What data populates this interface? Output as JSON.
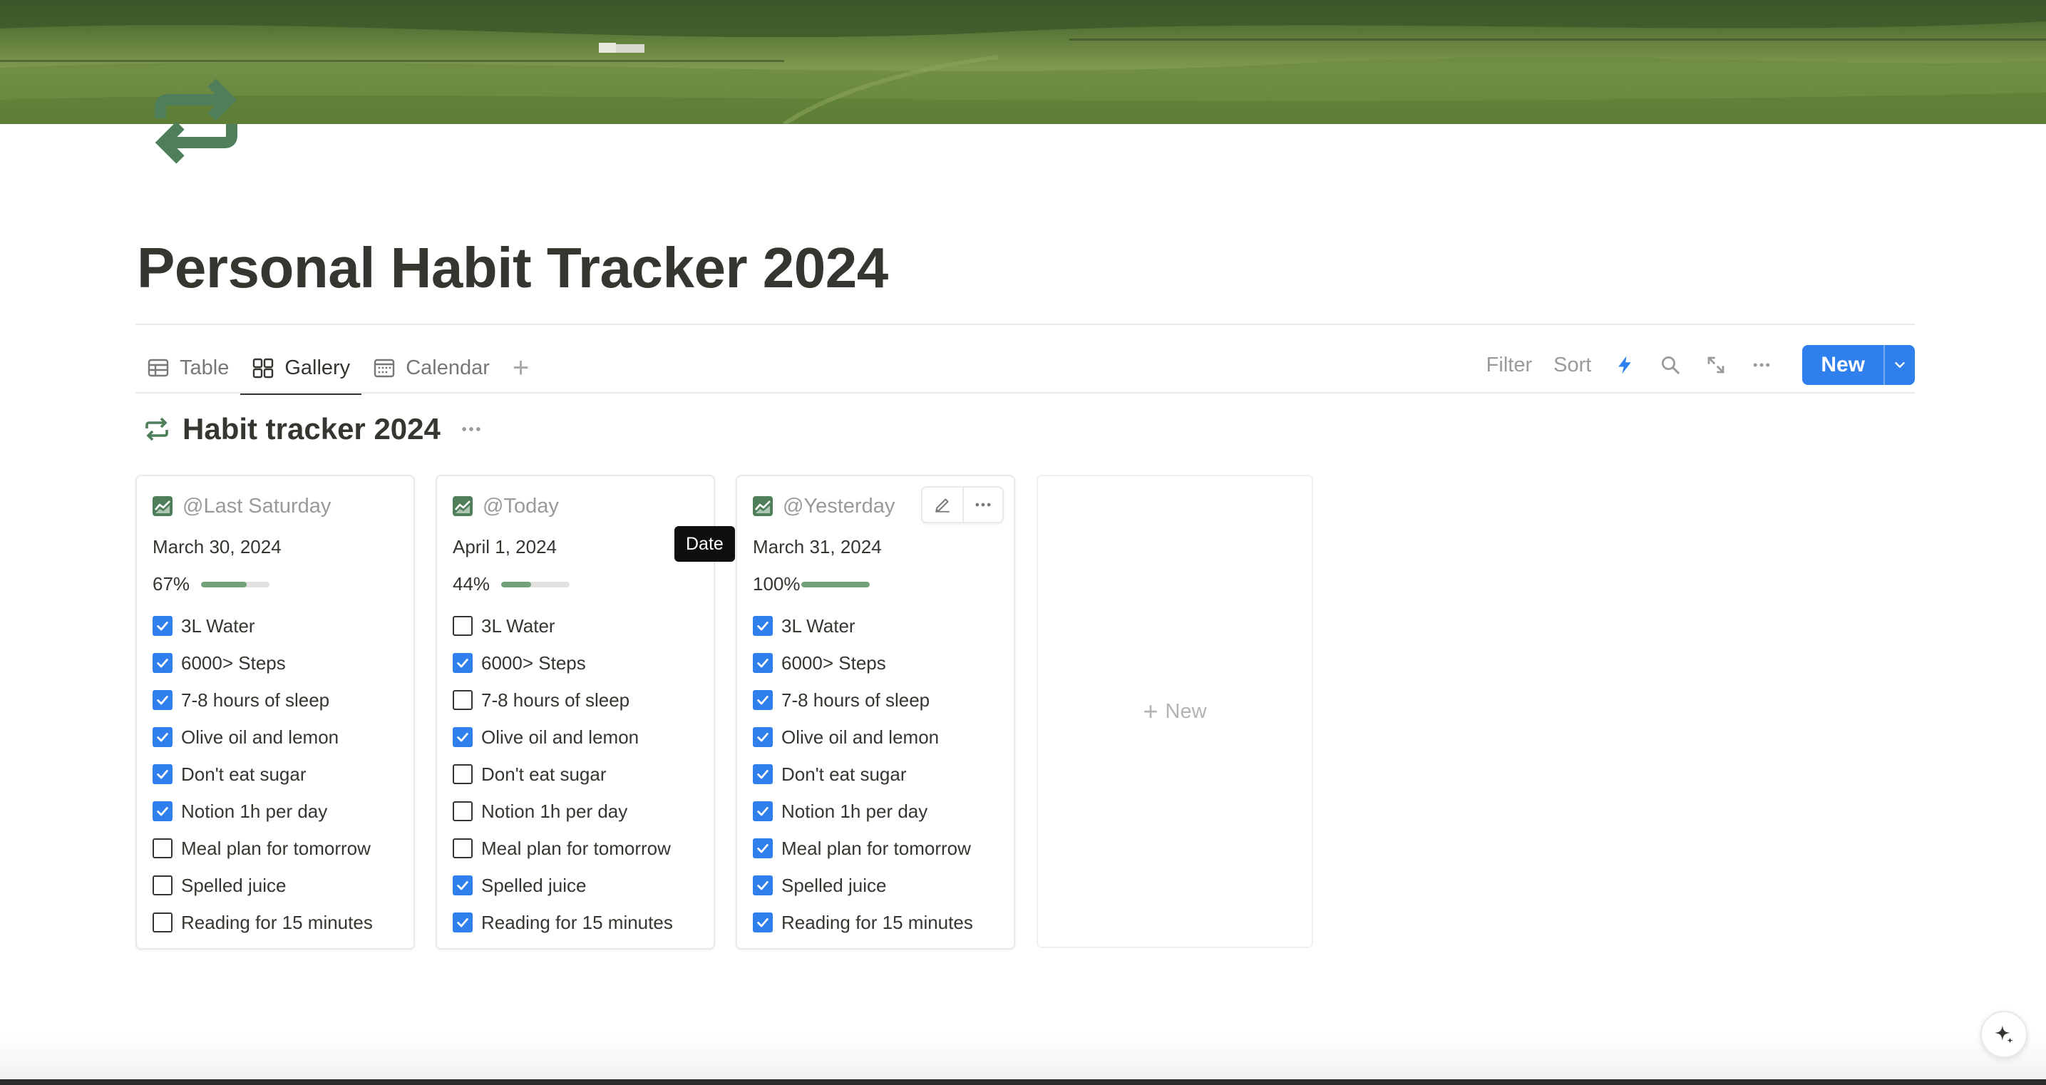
{
  "page": {
    "title": "Personal Habit Tracker 2024"
  },
  "tabs": [
    {
      "label": "Table",
      "icon": "table-icon"
    },
    {
      "label": "Gallery",
      "icon": "gallery-icon",
      "active": true
    },
    {
      "label": "Calendar",
      "icon": "calendar-icon"
    }
  ],
  "toolbar": {
    "filter_label": "Filter",
    "sort_label": "Sort",
    "new_label": "New"
  },
  "view": {
    "title": "Habit tracker 2024"
  },
  "tooltip": {
    "text": "Date"
  },
  "cards": [
    {
      "name": "@Last Saturday",
      "date": "March 30, 2024",
      "progress_label": "67%",
      "progress": 0.67,
      "habits": [
        {
          "label": "3L Water",
          "checked": true
        },
        {
          "label": "6000> Steps",
          "checked": true
        },
        {
          "label": "7-8 hours of sleep",
          "checked": true
        },
        {
          "label": "Olive oil and lemon",
          "checked": true
        },
        {
          "label": "Don't eat sugar",
          "checked": true
        },
        {
          "label": "Notion 1h per day",
          "checked": true
        },
        {
          "label": "Meal plan for tomorrow",
          "checked": false
        },
        {
          "label": "Spelled juice",
          "checked": false
        },
        {
          "label": "Reading for 15 minutes",
          "checked": false
        }
      ]
    },
    {
      "name": "@Today",
      "date": "April 1, 2024",
      "progress_label": "44%",
      "progress": 0.44,
      "habits": [
        {
          "label": "3L Water",
          "checked": false
        },
        {
          "label": "6000> Steps",
          "checked": true
        },
        {
          "label": "7-8 hours of sleep",
          "checked": false
        },
        {
          "label": "Olive oil and lemon",
          "checked": true
        },
        {
          "label": "Don't eat sugar",
          "checked": false
        },
        {
          "label": "Notion 1h per day",
          "checked": false
        },
        {
          "label": "Meal plan for tomorrow",
          "checked": false
        },
        {
          "label": "Spelled juice",
          "checked": true
        },
        {
          "label": "Reading for 15 minutes",
          "checked": true
        }
      ]
    },
    {
      "name": "@Yesterday",
      "date": "March 31, 2024",
      "progress_label": "100%",
      "progress": 1.0,
      "habits": [
        {
          "label": "3L Water",
          "checked": true
        },
        {
          "label": "6000> Steps",
          "checked": true
        },
        {
          "label": "7-8 hours of sleep",
          "checked": true
        },
        {
          "label": "Olive oil and lemon",
          "checked": true
        },
        {
          "label": "Don't eat sugar",
          "checked": true
        },
        {
          "label": "Notion 1h per day",
          "checked": true
        },
        {
          "label": "Meal plan for tomorrow",
          "checked": true
        },
        {
          "label": "Spelled juice",
          "checked": true
        },
        {
          "label": "Reading for 15 minutes",
          "checked": true
        }
      ]
    }
  ],
  "new_card": {
    "label": "New"
  },
  "colors": {
    "accent": "#2f80ed",
    "icon_green": "#4f7e5a",
    "progress_fill": "#73a178",
    "text": "#37352f",
    "muted": "#9b9a97"
  }
}
